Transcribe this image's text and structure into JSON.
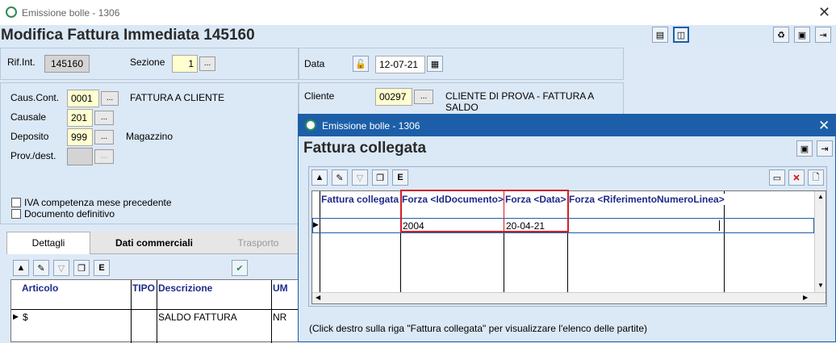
{
  "main_window": {
    "title": "Emissione bolle - 1306",
    "heading": "Modifica Fattura Immediata 145160",
    "rif_label": "Rif.Int.",
    "rif_value": "145160",
    "sezione_label": "Sezione",
    "sezione_value": "1",
    "data_label": "Data",
    "data_value": "12-07-21",
    "caus_cont_label": "Caus.Cont.",
    "caus_cont_code": "0001",
    "caus_cont_desc": "FATTURA A CLIENTE",
    "causale_label": "Causale",
    "causale_code": "201",
    "deposito_label": "Deposito",
    "deposito_code": "999",
    "deposito_desc": "Magazzino",
    "prov_label": "Prov./dest.",
    "cliente_label": "Cliente",
    "cliente_code": "00297",
    "cliente_desc": "CLIENTE DI PROVA - FATTURA A SALDO",
    "iva_label": "IVA competenza mese precedente",
    "doc_def_label": "Documento definitivo",
    "tabs": [
      "Dettagli",
      "Dati commerciali",
      "Trasporto"
    ],
    "grid_headers": [
      "Articolo",
      "TIPO",
      "Descrizione",
      "UM"
    ],
    "grid_row": {
      "articolo": "$",
      "tipo": "",
      "descrizione": "SALDO FATTURA",
      "um": "NR"
    }
  },
  "dialog": {
    "title": "Emissione bolle - 1306",
    "heading": "Fattura collegata",
    "headers": [
      "Fattura collegata",
      "Forza <IdDocumento>",
      "Forza <Data>",
      "Forza <RiferimentoNumeroLinea>"
    ],
    "row": {
      "fattura": "",
      "id_documento": "2004",
      "data": "20-04-21",
      "rif_linea": ""
    },
    "footer": "(Click destro sulla riga \"Fattura collegata\" per visualizzare l'elenco delle partite)"
  },
  "colors": {
    "highlight": "#d11f2a",
    "header_text": "#1f2a8a",
    "dialog_titlebar": "#1c5fa8"
  }
}
